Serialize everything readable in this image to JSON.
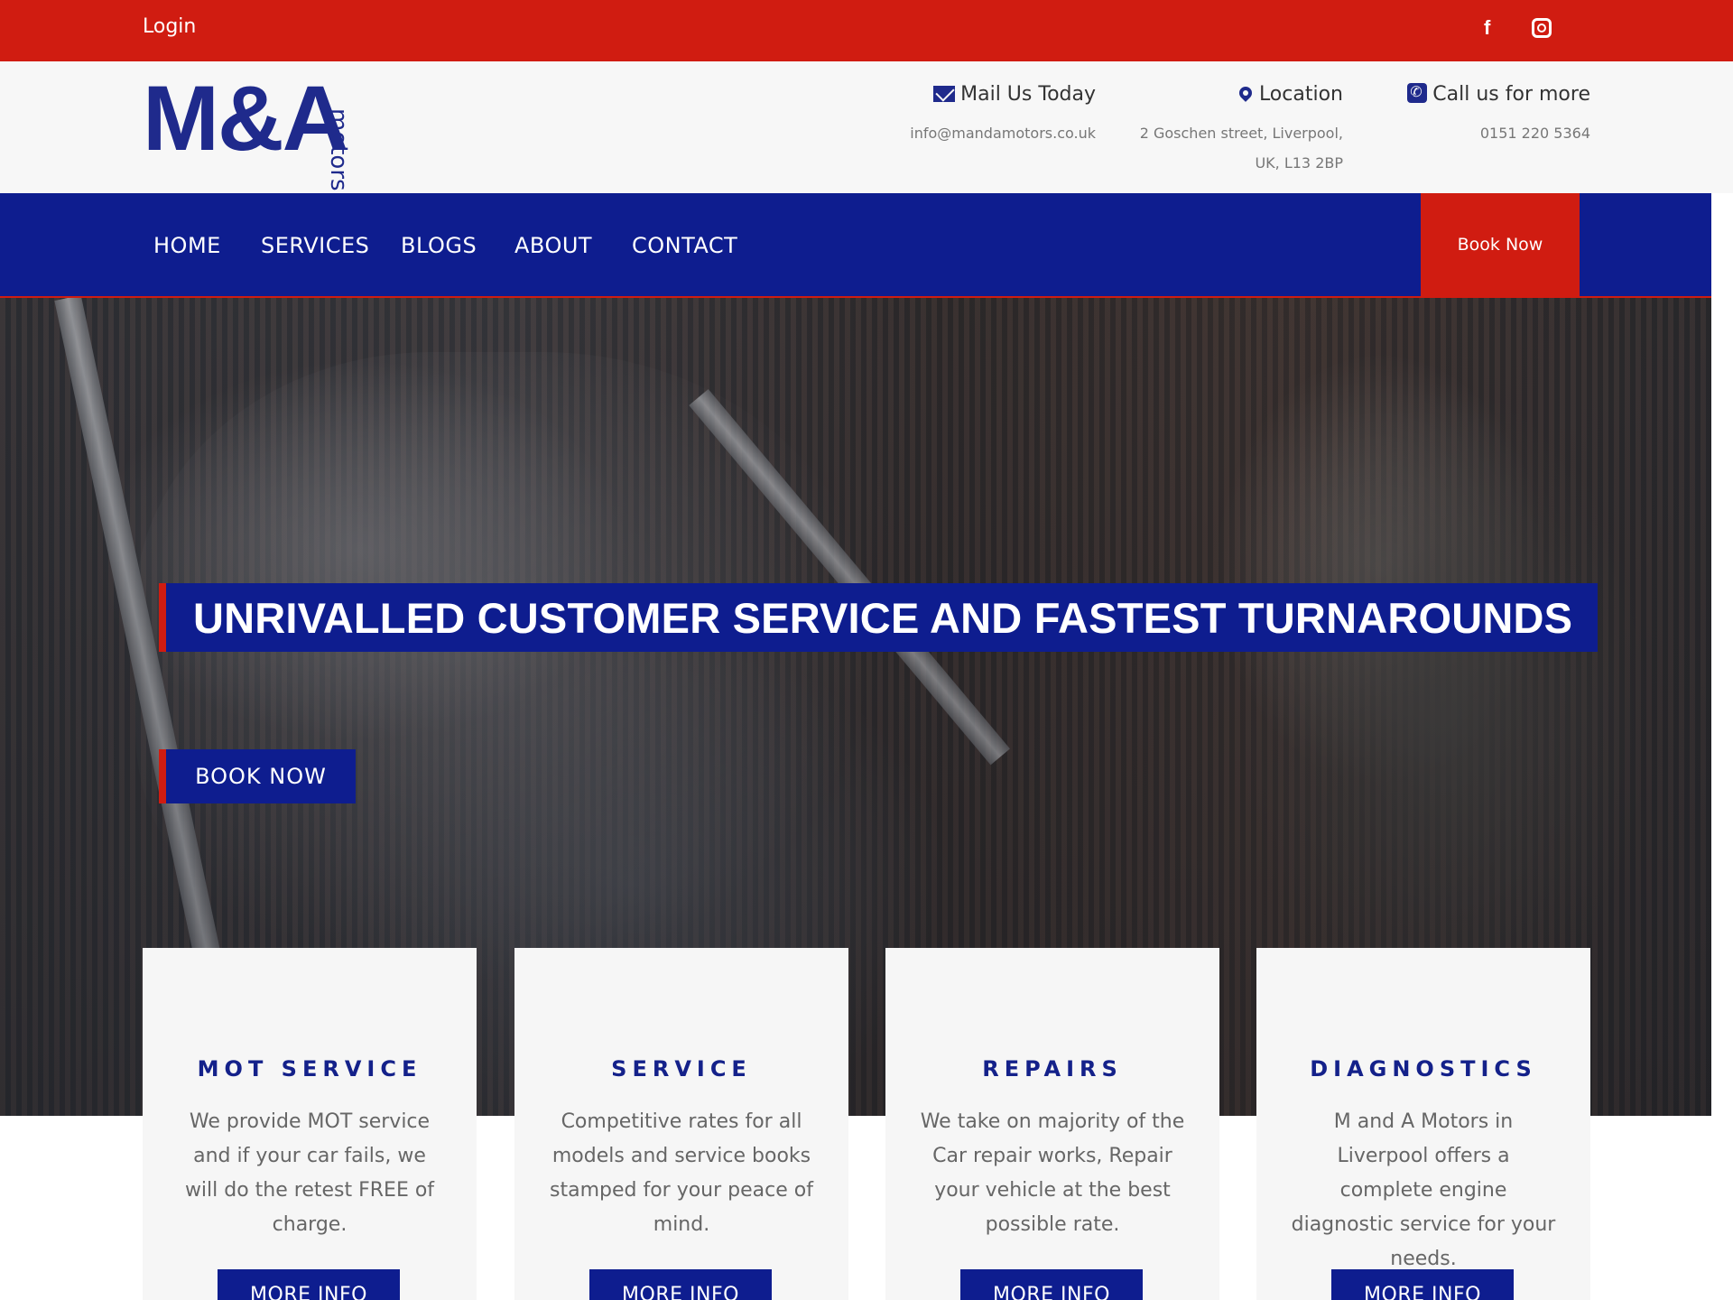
{
  "topbar": {
    "login_label": "Login",
    "social": [
      {
        "name": "facebook",
        "glyph": "f"
      },
      {
        "name": "instagram",
        "glyph": ""
      }
    ]
  },
  "header": {
    "logo": {
      "main": "M&A",
      "sub": "motors"
    },
    "contacts": [
      {
        "title": "Mail Us Today",
        "lines": [
          "info@mandamotors.co.uk"
        ],
        "icon": "envelope-icon"
      },
      {
        "title": "Location",
        "lines": [
          "2 Goschen street, Liverpool,",
          "UK, L13 2BP"
        ],
        "icon": "map-pin-icon"
      },
      {
        "title": "Call us for more",
        "lines": [
          "0151 220 5364"
        ],
        "icon": "phone-icon"
      }
    ]
  },
  "nav": {
    "items": [
      "HOME",
      "SERVICES",
      "BLOGS",
      "ABOUT",
      "CONTACT"
    ],
    "book_now_label": "Book Now"
  },
  "hero": {
    "headline": "UNRIVALLED CUSTOMER SERVICE AND FASTEST TURNAROUNDS",
    "button_label": "BOOK NOW"
  },
  "cards": [
    {
      "title": "MOT SERVICE",
      "text": "We provide MOT service and if your car fails, we will do the retest FREE of charge.",
      "button": "MORE INFO"
    },
    {
      "title": "SERVICE",
      "text": "Competitive rates for all models and service books stamped for your peace of mind.",
      "button": "MORE INFO"
    },
    {
      "title": "REPAIRS",
      "text": "We take on majority of the Car repair works, Repair your vehicle at the best possible rate.",
      "button": "MORE INFO"
    },
    {
      "title": "DIAGNOSTICS",
      "text": "M and A Motors in Liverpool offers a complete engine diagnostic service for your needs.",
      "button": "MORE INFO"
    }
  ],
  "colors": {
    "brand_red": "#d01c11",
    "brand_blue": "#0e1d8f",
    "logo_blue": "#1f2a8c"
  }
}
